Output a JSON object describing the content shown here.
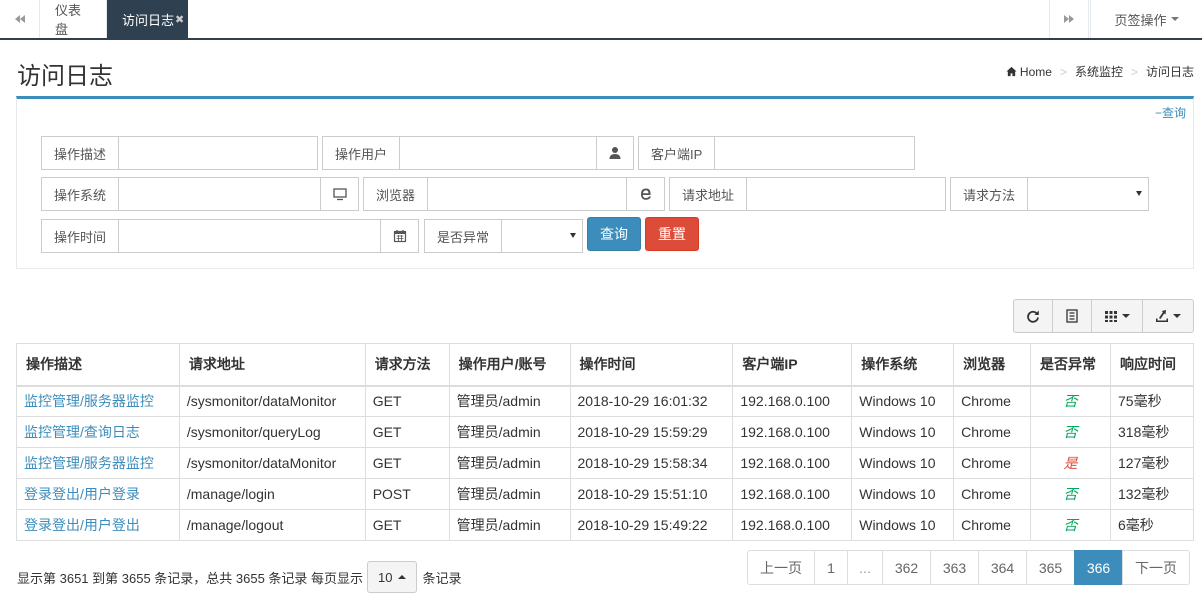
{
  "tabs": {
    "items": [
      {
        "label": "仪表盘"
      },
      {
        "label": "访问日志",
        "close": "✖"
      }
    ],
    "actions_label": "页签操作"
  },
  "header": {
    "title": "访问日志",
    "breadcrumb": [
      "Home",
      "系统监控",
      "访问日志"
    ]
  },
  "search": {
    "collapse_label": "查询",
    "fields": {
      "desc": {
        "label": "操作描述",
        "value": ""
      },
      "user": {
        "label": "操作用户",
        "value": ""
      },
      "ip": {
        "label": "客户端IP",
        "value": ""
      },
      "os": {
        "label": "操作系统",
        "value": ""
      },
      "browser": {
        "label": "浏览器",
        "value": ""
      },
      "url": {
        "label": "请求地址",
        "value": ""
      },
      "method": {
        "label": "请求方法",
        "value": ""
      },
      "time": {
        "label": "操作时间",
        "value": ""
      },
      "exception": {
        "label": "是否异常",
        "value": ""
      }
    },
    "query_button": "查询",
    "reset_button": "重置"
  },
  "toolbar": {
    "icons": [
      "refresh-icon",
      "toggle-view-icon",
      "columns-icon",
      "export-icon"
    ]
  },
  "table": {
    "columns": [
      "操作描述",
      "请求地址",
      "请求方法",
      "操作用户/账号",
      "操作时间",
      "客户端IP",
      "操作系统",
      "浏览器",
      "是否异常",
      "响应时间"
    ],
    "rows": [
      {
        "desc": "监控管理/服务器监控",
        "url": "/sysmonitor/dataMonitor",
        "method": "GET",
        "user": "管理员/admin",
        "time": "2018-10-29 16:01:32",
        "ip": "192.168.0.100",
        "os": "Windows 10",
        "browser": "Chrome",
        "exception": "否",
        "is_exception": false,
        "resp": "75毫秒"
      },
      {
        "desc": "监控管理/查询日志",
        "url": "/sysmonitor/queryLog",
        "method": "GET",
        "user": "管理员/admin",
        "time": "2018-10-29 15:59:29",
        "ip": "192.168.0.100",
        "os": "Windows 10",
        "browser": "Chrome",
        "exception": "否",
        "is_exception": false,
        "resp": "318毫秒"
      },
      {
        "desc": "监控管理/服务器监控",
        "url": "/sysmonitor/dataMonitor",
        "method": "GET",
        "user": "管理员/admin",
        "time": "2018-10-29 15:58:34",
        "ip": "192.168.0.100",
        "os": "Windows 10",
        "browser": "Chrome",
        "exception": "是",
        "is_exception": true,
        "resp": "127毫秒"
      },
      {
        "desc": "登录登出/用户登录",
        "url": "/manage/login",
        "method": "POST",
        "user": "管理员/admin",
        "time": "2018-10-29 15:51:10",
        "ip": "192.168.0.100",
        "os": "Windows 10",
        "browser": "Chrome",
        "exception": "否",
        "is_exception": false,
        "resp": "132毫秒"
      },
      {
        "desc": "登录登出/用户登出",
        "url": "/manage/logout",
        "method": "GET",
        "user": "管理员/admin",
        "time": "2018-10-29 15:49:22",
        "ip": "192.168.0.100",
        "os": "Windows 10",
        "browser": "Chrome",
        "exception": "否",
        "is_exception": false,
        "resp": "6毫秒"
      }
    ]
  },
  "pagination": {
    "info_prefix": "显示第 3651 到第 3655 条记录，总共 3655 条记录 每页显示",
    "page_size": "10",
    "info_suffix": "条记录",
    "prev": "上一页",
    "next": "下一页",
    "pages": [
      "1",
      "...",
      "362",
      "363",
      "364",
      "365",
      "366"
    ],
    "current": "366"
  },
  "colors": {
    "accent": "#3c8dbc",
    "danger": "#dd4b39",
    "success": "#00a65a",
    "tab_active_bg": "#2f4050"
  }
}
